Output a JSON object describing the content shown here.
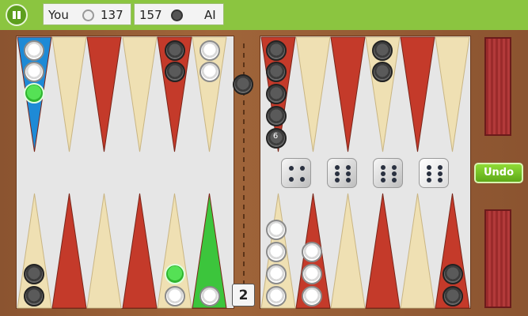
{
  "header": {
    "player_label": "You",
    "player_pips": "137",
    "ai_pips": "157",
    "ai_label": "AI"
  },
  "board": {
    "colors": {
      "red": "#c43a2a",
      "cream": "#efe0b3",
      "blue": "#1e8ad6",
      "green": "#3cc53c"
    },
    "point_colors_top": [
      "cream",
      "blue",
      "cream",
      "red",
      "cream",
      "red",
      "cream",
      "red",
      "cream",
      "red",
      "cream",
      "red"
    ],
    "stack_label": "6",
    "doubling_cube": "2"
  },
  "dice": [
    4,
    6,
    6,
    6
  ],
  "undo_label": "Undo"
}
